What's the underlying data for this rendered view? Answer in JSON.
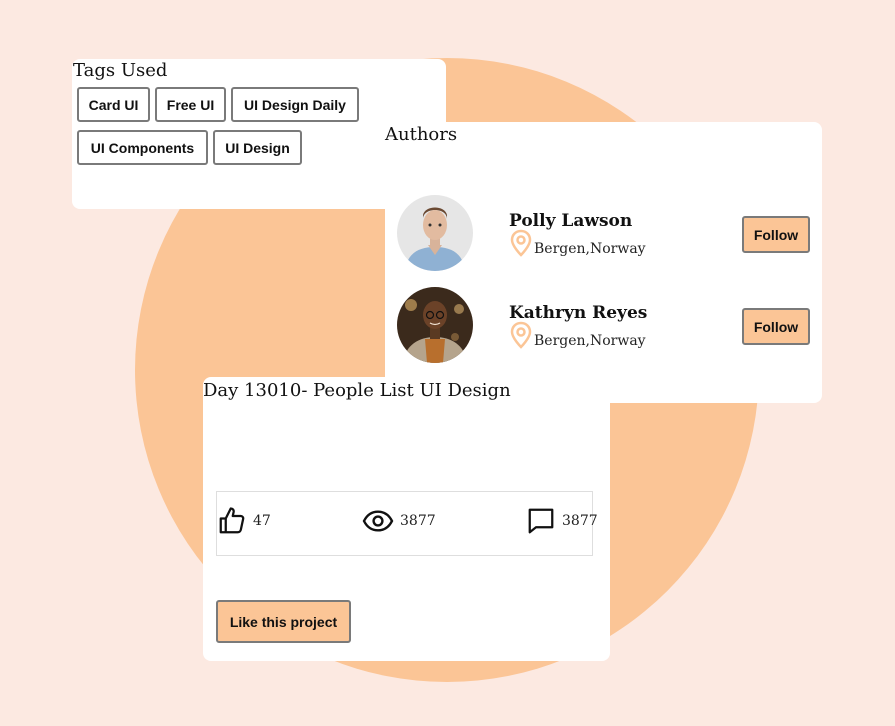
{
  "colors": {
    "background": "#fce9e1",
    "accent": "#fbc596",
    "card": "#ffffff",
    "border": "#7a7a7a"
  },
  "tags": {
    "title": "Tags Used",
    "items": [
      "Card UI",
      "Free UI",
      "UI Design Daily",
      "UI Components",
      "UI Design"
    ]
  },
  "authors": {
    "title": "Authors",
    "people": [
      {
        "name": "Polly Lawson",
        "location": "Bergen,Norway",
        "follow_label": "Follow"
      },
      {
        "name": "Kathryn Reyes",
        "location": "Bergen,Norway",
        "follow_label": "Follow"
      }
    ]
  },
  "project": {
    "title": "Day 13010- People List UI Design",
    "stats": {
      "likes": "47",
      "likes_icon": "thumbs-up-icon",
      "views": "3877",
      "views_icon": "eye-icon",
      "comments": "3877",
      "comments_icon": "comment-icon"
    },
    "like_button_label": "Like this project"
  }
}
